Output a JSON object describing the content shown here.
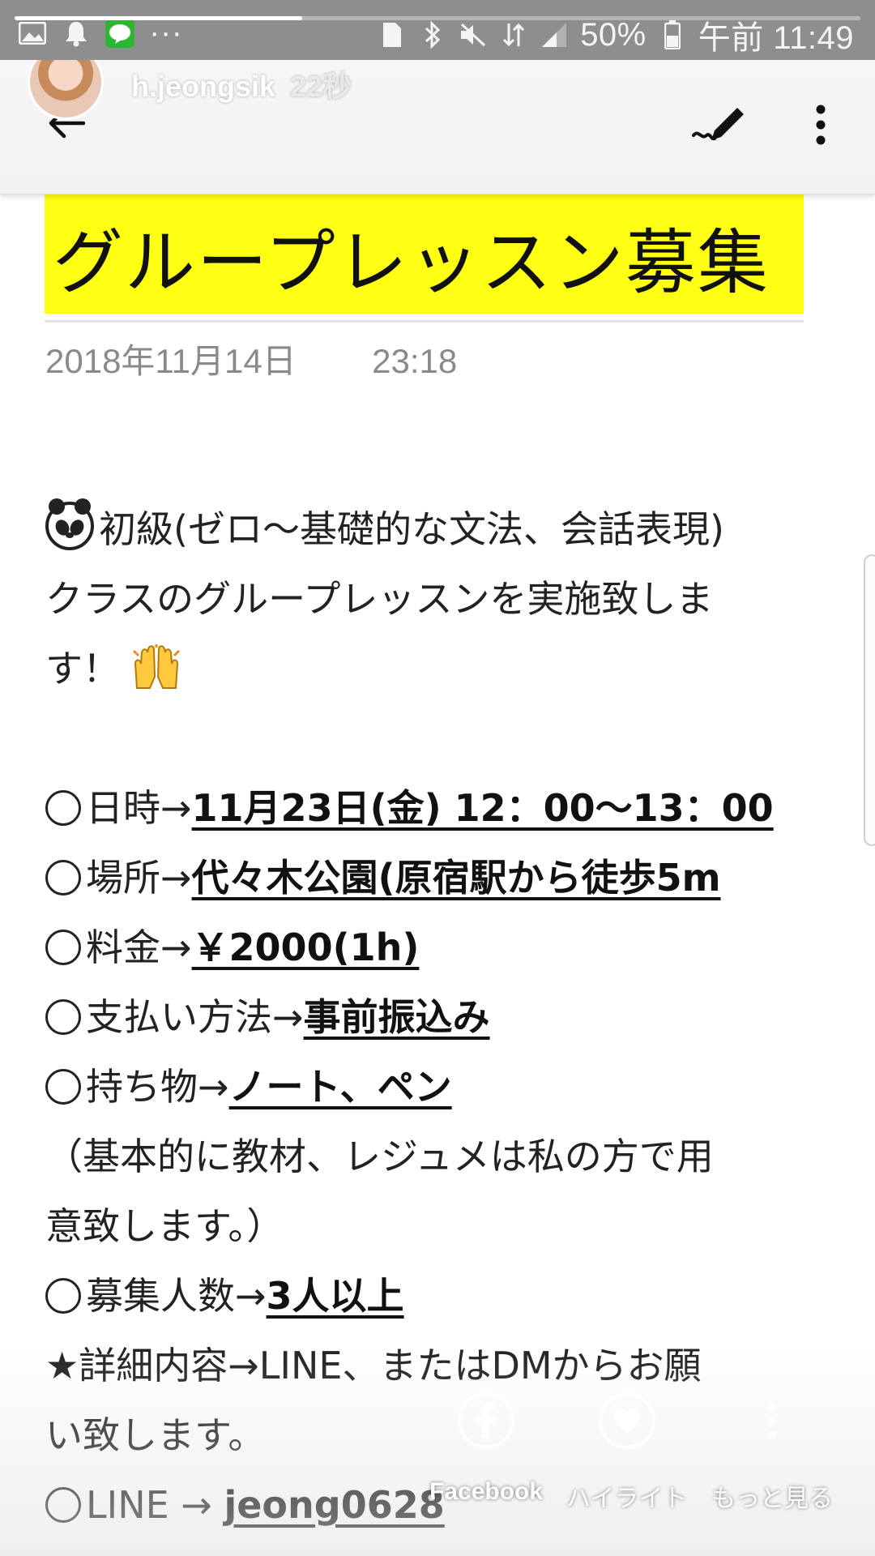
{
  "status_bar": {
    "battery_percent": "50%",
    "time": "午前 11:49",
    "more_indicator": "···"
  },
  "story": {
    "username": "h.jeongsik",
    "time_ago": "22秒",
    "progress_fraction": 0.34
  },
  "post": {
    "title": "グループレッスン募集",
    "date": "2018年11月14日",
    "time": "23:18",
    "intro_lines": [
      "初級(ゼロ～基礎的な文法、会話表現)",
      "クラスのグループレッスンを実施致しま",
      "す！"
    ],
    "details": [
      {
        "label": "日時→",
        "value": "11月23日(金) 12：00～13：00"
      },
      {
        "label": "場所→",
        "value": "代々木公園(原宿駅から徒歩5m"
      },
      {
        "label": "料金→",
        "value": "￥2000(1h)"
      },
      {
        "label": "支払い方法→",
        "value": "事前振込み"
      },
      {
        "label": "持ち物→",
        "value": "ノート、ペン"
      }
    ],
    "note_lines": [
      "（基本的に教材、レジュメは私の方で用",
      "意致します。）"
    ],
    "capacity": {
      "label": "募集人数→",
      "value": "3人以上"
    },
    "contact_lines": [
      "★詳細内容→LINE、またはDMからお願",
      "い致します。"
    ],
    "line_id": {
      "label": "LINE → ",
      "value": "jeong0628"
    }
  },
  "bottom_actions": {
    "facebook": "Facebook",
    "highlight": "ハイライト",
    "more": "もっと見る"
  }
}
